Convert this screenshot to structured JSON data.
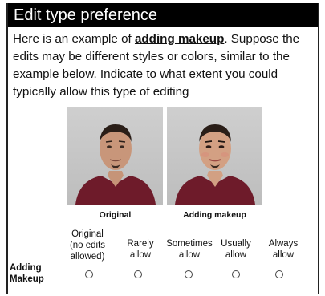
{
  "header": {
    "title": "Edit type preference"
  },
  "prompt": {
    "before": "Here is an example of ",
    "emphasis": "adding makeup",
    "after": ". Suppose the edits may be different styles or colors, similar to the example below. Indicate to what extent you could typically allow this type of editing"
  },
  "example": {
    "original_label": "Original",
    "edited_label": "Adding makeup"
  },
  "scale": {
    "options": [
      {
        "label": "Original (no edits allowed)"
      },
      {
        "label": "Rarely allow"
      },
      {
        "label": "Sometimes allow"
      },
      {
        "label": "Usually allow"
      },
      {
        "label": "Always allow"
      }
    ]
  },
  "question": {
    "row_label": "Adding Makeup"
  },
  "colors": {
    "title_bg": "#000000",
    "shirt": "#6e1b2a",
    "photo_bg": "#c8c8c8"
  }
}
